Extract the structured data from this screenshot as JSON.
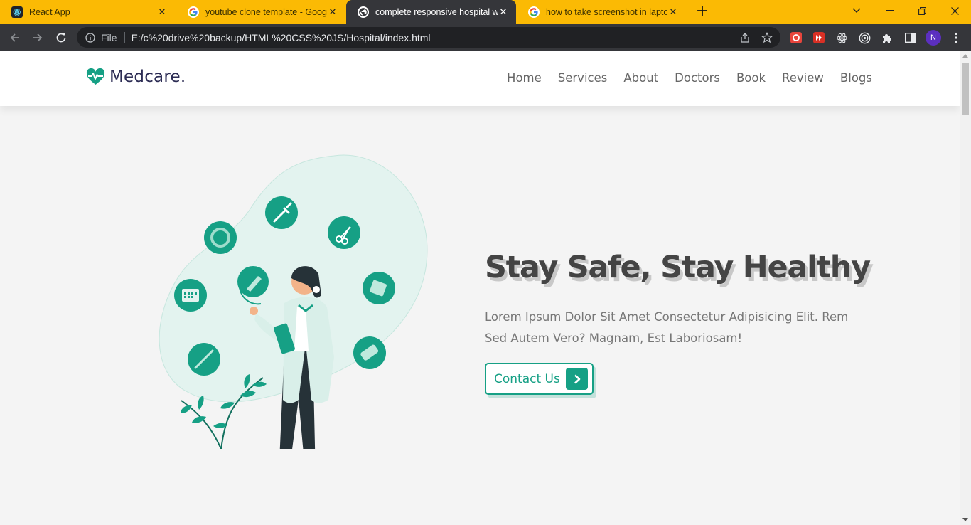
{
  "browser": {
    "tabs": [
      {
        "title": "React App",
        "favicon": "react-icon",
        "active": false
      },
      {
        "title": "youtube clone template - Google",
        "favicon": "google-icon",
        "active": false
      },
      {
        "title": "complete responsive hospital web",
        "favicon": "globe-icon",
        "active": true
      },
      {
        "title": "how to take screenshot in laptop",
        "favicon": "google-icon",
        "active": false
      }
    ],
    "address": {
      "scheme_label": "File",
      "url": "E:/c%20drive%20backup/HTML%20CSS%20JS/Hospital/index.html"
    },
    "profile_initial": "N",
    "colors": {
      "tabstrip": "#fbba04",
      "toolbar": "#35363a",
      "omnibox": "#202124"
    }
  },
  "site": {
    "logo_text": "Medcare.",
    "nav": [
      "Home",
      "Services",
      "About",
      "Doctors",
      "Book",
      "Review",
      "Blogs"
    ],
    "hero": {
      "title": "Stay Safe, Stay Healthy",
      "text": "Lorem Ipsum Dolor Sit Amet Consectetur Adipisicing Elit. Rem Sed Autem Vero? Magnam, Est Laboriosam!",
      "cta_label": "Contact Us"
    },
    "colors": {
      "accent": "#16a085",
      "heading": "#444444",
      "body_text": "#777777",
      "background": "#f4f4f4"
    }
  }
}
